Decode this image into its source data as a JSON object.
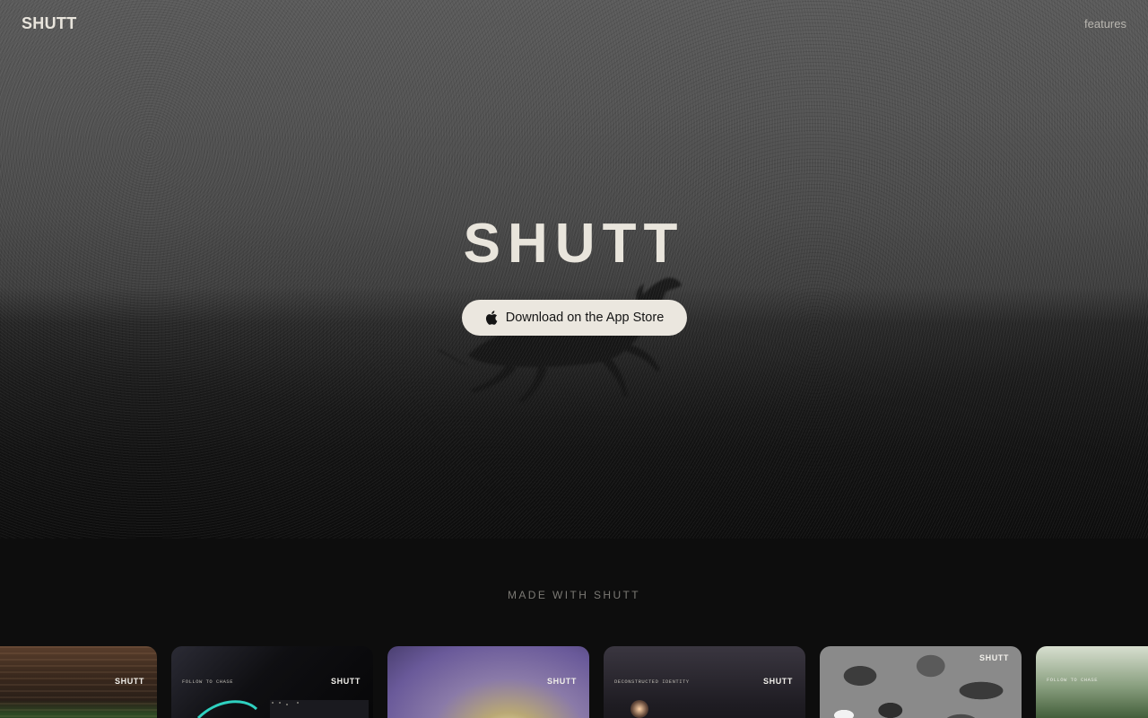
{
  "header": {
    "brand": "SHUTT",
    "nav_features": "features"
  },
  "hero": {
    "title": "SHUTT",
    "cta_label": "Download on the App Store",
    "cta_icon": "apple-icon"
  },
  "gallery": {
    "label": "MADE WITH SHUTT",
    "cards": [
      {
        "logo": "SHUTT",
        "caption": ""
      },
      {
        "logo": "SHUTT",
        "caption": "FOLLOW TO CHASE"
      },
      {
        "logo": "SHUTT",
        "caption": ""
      },
      {
        "logo": "SHUTT",
        "caption": "DECONSTRUCTED IDENTITY"
      },
      {
        "logo": "SHUTT",
        "caption": ""
      },
      {
        "logo": "",
        "caption": "FOLLOW TO CHASE"
      }
    ]
  },
  "colors": {
    "background": "#0d0d0d",
    "text_primary": "#e8e4dc",
    "button_bg": "#ebe7df",
    "button_text": "#151515",
    "muted": "#7b7974",
    "accent_teal": "#2fd1c0"
  }
}
